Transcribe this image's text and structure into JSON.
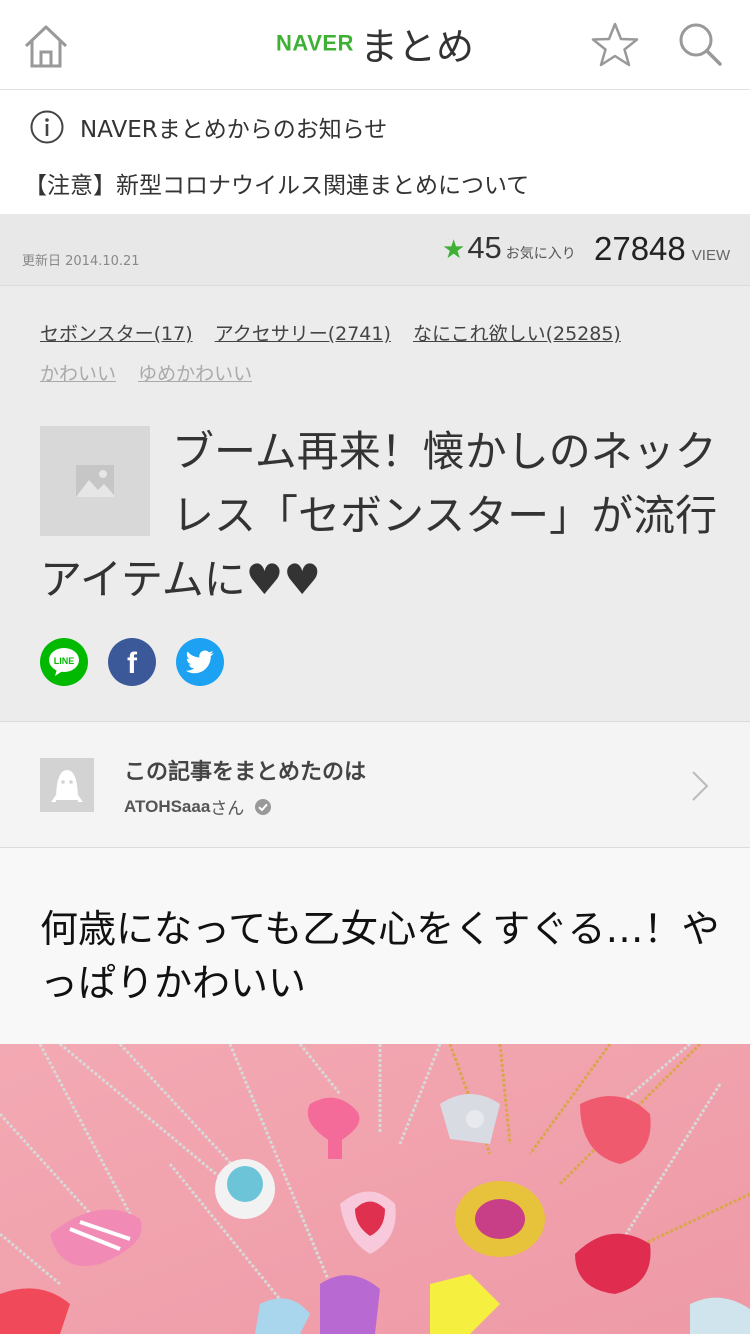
{
  "header": {
    "logo_brand": "NAVER",
    "logo_service": "まとめ",
    "icons": [
      "home-icon",
      "star-icon",
      "search-icon"
    ]
  },
  "notice": {
    "title": "NAVERまとめからのお知らせ",
    "link": "【注意】新型コロナウイルス関連まとめについて"
  },
  "stats": {
    "updated": "更新日 2014.10.21",
    "favorites_count": "45",
    "favorites_label": "お気に入り",
    "views_count": "27848",
    "views_label": "VIEW"
  },
  "article": {
    "tags": [
      {
        "label": "セボンスター(17)"
      },
      {
        "label": "アクセサリー(2741)"
      },
      {
        "label": "なにこれ欲しい(25285)"
      },
      {
        "label": "かわいい"
      },
      {
        "label": "ゆめかわいい"
      }
    ],
    "title": "ブーム再来！懐かしのネックレス「セボンスター」が流行アイテムに♥♥",
    "share": {
      "line_text": "LINE",
      "facebook_text": "f"
    }
  },
  "author": {
    "heading": "この記事をまとめたのは",
    "name": "ATOHSaaa",
    "suffix": "さん"
  },
  "section": {
    "title": "何歳になっても乙女心をくすぐる…！やっぱりかわいい"
  },
  "colors": {
    "brand_green": "#3eb135",
    "line_green": "#00b900",
    "facebook_blue": "#3b5998",
    "twitter_blue": "#1da1f2"
  }
}
